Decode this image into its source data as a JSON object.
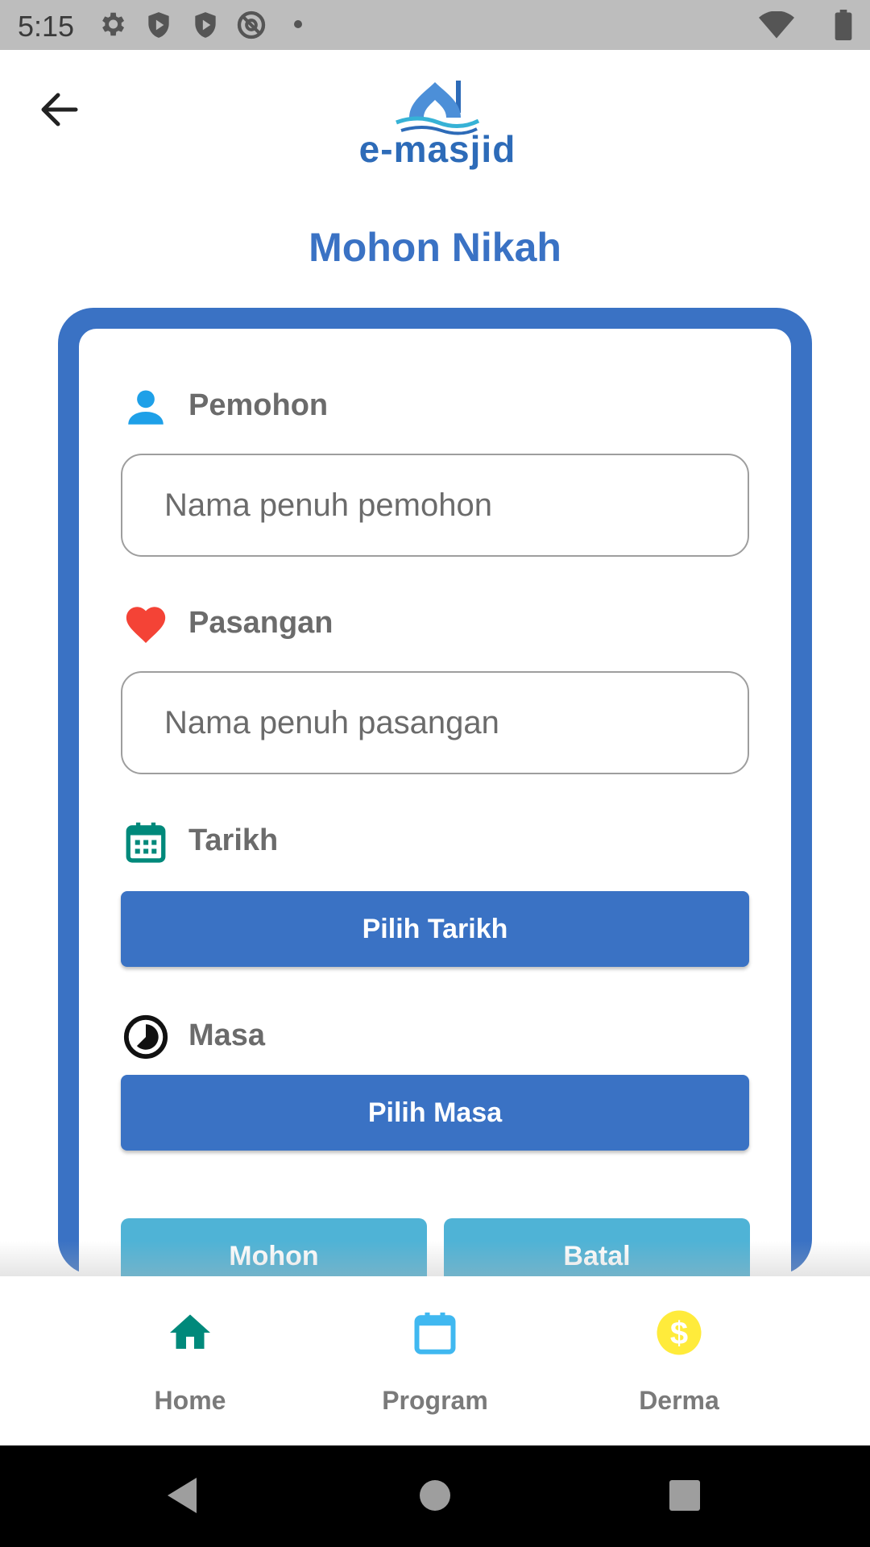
{
  "status_bar": {
    "time": "5:15",
    "icons_left": [
      "gear-icon",
      "shield-play-icon",
      "shield-play-icon",
      "at-sign-icon",
      "dot-icon"
    ],
    "icons_right": [
      "wifi-icon",
      "battery-icon"
    ]
  },
  "header": {
    "back_icon": "arrow-left-icon",
    "logo_text": "e-masjid",
    "title": "Mohon Nikah"
  },
  "form": {
    "pemohon": {
      "label": "Pemohon",
      "icon": "person-icon",
      "placeholder": "Nama penuh pemohon",
      "value": ""
    },
    "pasangan": {
      "label": "Pasangan",
      "icon": "heart-icon",
      "placeholder": "Nama penuh pasangan",
      "value": ""
    },
    "tarikh": {
      "label": "Tarikh",
      "icon": "calendar-icon",
      "button": "Pilih Tarikh"
    },
    "masa": {
      "label": "Masa",
      "icon": "clock-icon",
      "button": "Pilih Masa"
    },
    "actions": {
      "submit": "Mohon",
      "cancel": "Batal"
    }
  },
  "bottom_nav": {
    "items": [
      {
        "label": "Home",
        "icon": "home-icon"
      },
      {
        "label": "Program",
        "icon": "calendar-icon"
      },
      {
        "label": "Derma",
        "icon": "dollar-coin-icon"
      }
    ]
  },
  "colors": {
    "primary": "#3a72c4",
    "action": "#4fb3d6",
    "person_icon": "#1ea0e8",
    "heart_icon": "#f44336",
    "calendar_icon": "#00897b",
    "home_icon": "#00897b",
    "program_icon": "#40b8f0",
    "derma_icon": "#ffeb3b"
  },
  "system_nav": [
    "back-triangle-icon",
    "home-circle-icon",
    "recents-square-icon"
  ]
}
